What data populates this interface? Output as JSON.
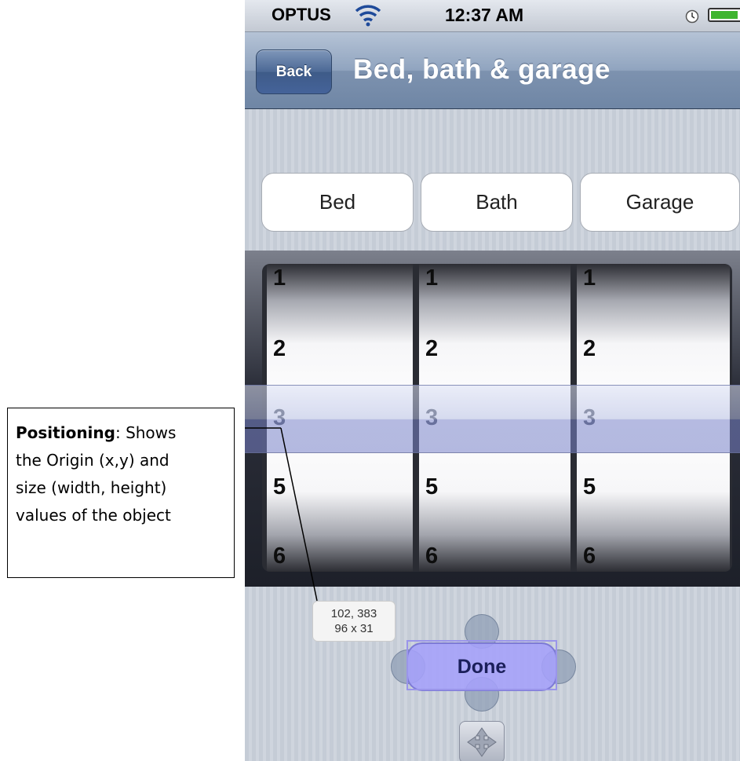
{
  "callout": {
    "heading": "Positioning",
    "text_line1": ": Shows",
    "text_line2": "the Origin (x,y) and",
    "text_line3": "size (width, height)",
    "text_line4": "values of the object"
  },
  "statusbar": {
    "carrier": "OPTUS",
    "time": "12:37 AM",
    "icons": [
      "signal-icon",
      "wifi-icon",
      "alarm-icon",
      "battery-icon"
    ]
  },
  "navbar": {
    "back_label": "Back",
    "title": "Bed, bath & garage"
  },
  "segments": [
    {
      "label": "Bed"
    },
    {
      "label": "Bath"
    },
    {
      "label": "Garage"
    }
  ],
  "picker": {
    "columns": [
      {
        "rows": [
          "1",
          "2",
          "3",
          "5",
          "6"
        ],
        "selected": "3"
      },
      {
        "rows": [
          "1",
          "2",
          "3",
          "5",
          "6"
        ],
        "selected": "3"
      },
      {
        "rows": [
          "1",
          "2",
          "3",
          "5",
          "6"
        ],
        "selected": "3"
      }
    ]
  },
  "position_tooltip": {
    "origin": "102, 383",
    "size": "96 x 31"
  },
  "done_label": "Done",
  "colors": {
    "navbar": "#7d92af",
    "done_button": "#a5a0fa",
    "selection_bar": "#7882c8"
  }
}
